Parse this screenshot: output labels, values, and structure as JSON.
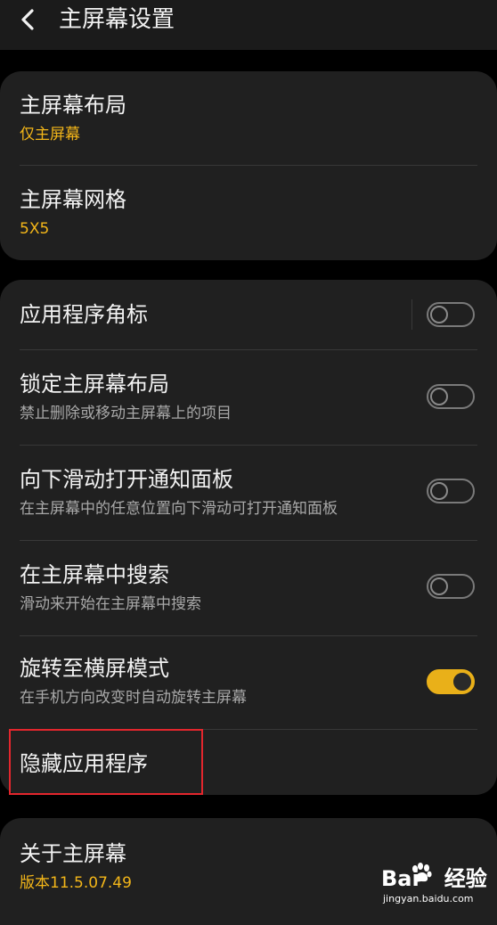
{
  "header": {
    "back_icon": "chevron-left-icon",
    "title": "主屏幕设置"
  },
  "layout_group": {
    "items": [
      {
        "title": "主屏幕布局",
        "value": "仅主屏幕"
      },
      {
        "title": "主屏幕网格",
        "value": "5X5"
      }
    ]
  },
  "toggle_group": {
    "items": [
      {
        "title": "应用程序角标",
        "subtitle": "",
        "enabled": false
      },
      {
        "title": "锁定主屏幕布局",
        "subtitle": "禁止删除或移动主屏幕上的项目",
        "enabled": false
      },
      {
        "title": "向下滑动打开通知面板",
        "subtitle": "在主屏幕中的任意位置向下滑动可打开通知面板",
        "enabled": false
      },
      {
        "title": "在主屏幕中搜索",
        "subtitle": "滑动来开始在主屏幕中搜索",
        "enabled": false
      },
      {
        "title": "旋转至横屏模式",
        "subtitle": "在手机方向改变时自动旋转主屏幕",
        "enabled": true
      },
      {
        "title": "隐藏应用程序"
      }
    ]
  },
  "about": {
    "title": "关于主屏幕",
    "version": "版本11.5.07.49"
  },
  "watermark": {
    "brand_left": "Bai",
    "brand_right": "经验",
    "url": "jingyan.baidu.com"
  },
  "colors": {
    "background": "#000000",
    "card": "#202020",
    "accent": "#f3b619",
    "toggle_on": "#e9b019",
    "highlight_box": "#e3262d"
  }
}
